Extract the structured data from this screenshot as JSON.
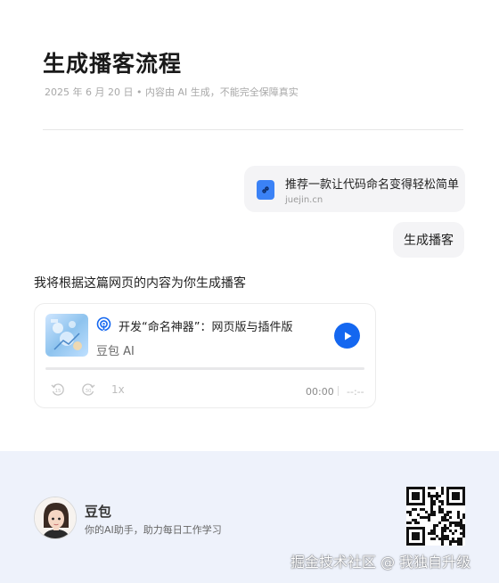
{
  "article": {
    "title": "生成播客流程",
    "meta": "2025 年 6 月 20 日 • 内容由 AI 生成，不能完全保障真实"
  },
  "link_card": {
    "title": "推荐一款让代码命名变得轻松简单",
    "domain": "juejin.cn",
    "icon": "link-icon",
    "icon_color": "#3b82f6"
  },
  "user_message": "生成播客",
  "assistant_reply": "我将根据这篇网页的内容为你生成播客",
  "podcast": {
    "title": "开发“命名神器”：网页版与插件版",
    "author": "豆包 AI",
    "speed": "1x",
    "current_time": "00:00",
    "total_time": "--:--",
    "progress": 0,
    "accent_color": "#1467f0",
    "icons": [
      "podcast-icon",
      "play-icon",
      "rewind-15-icon",
      "forward-30-icon"
    ]
  },
  "footer": {
    "brand": "豆包",
    "tagline": "你的AI助手，助力每日工作学习",
    "watermark": "掘金技术社区 @ 我独自升级",
    "background": "#eef2fb"
  }
}
